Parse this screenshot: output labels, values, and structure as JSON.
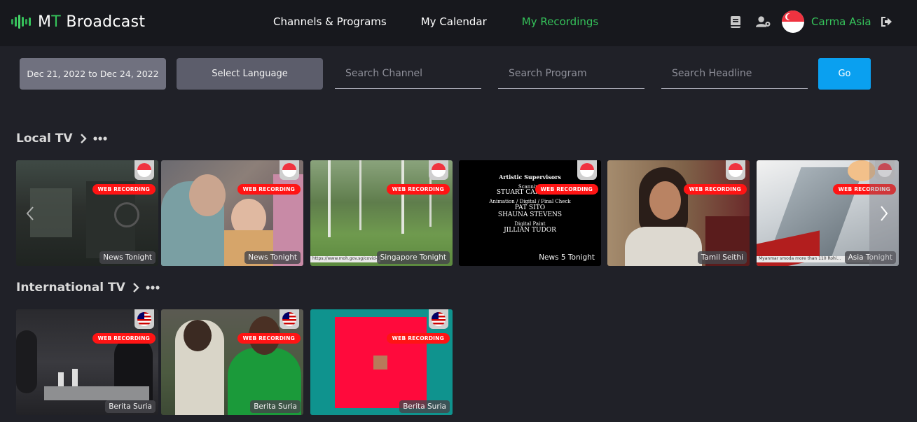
{
  "brand": {
    "name_prefix": "M",
    "name_accent": "T",
    "name_suffix": " Broadcast",
    "colors": {
      "accent": "#35c25a",
      "bars": [
        "#2fa651",
        "#35c25a",
        "#48d36a",
        "#35c25a",
        "#2fa651"
      ]
    }
  },
  "nav": {
    "items": [
      "Channels & Programs",
      "My Calendar",
      "My Recordings"
    ],
    "active": "My Recordings"
  },
  "header_icons": [
    "book-icon",
    "user-settings-icon",
    "singapore-flag-icon",
    "logout-icon"
  ],
  "user": {
    "name": "Carma Asia"
  },
  "filter": {
    "date_range": "Dec 21, 2022 to Dec 24, 2022",
    "language": "Select Language",
    "channel_placeholder": "Search Channel",
    "program_placeholder": "Search Program",
    "headline_placeholder": "Search Headline",
    "go": "Go"
  },
  "sections": {
    "local": {
      "title": "Local TV",
      "cards": [
        {
          "badge": "WEB RECORDING",
          "program": "News Tonight",
          "flag": "singapore"
        },
        {
          "badge": "WEB RECORDING",
          "program": "News Tonight",
          "flag": "singapore"
        },
        {
          "badge": "WEB RECORDING",
          "program": "Singapore Tonight",
          "flag": "singapore",
          "ticker": "https://www.moh.gov.sg/covid-19"
        },
        {
          "badge": "WEB RECORDING",
          "program": "News 5 Tonight",
          "flag": "singapore",
          "credits": [
            "Artistic Supervisors",
            "Scanning",
            "STUART CAMPBELL",
            "Animation / Digital / Final Check",
            "PAT SITO",
            "SHAUNA STEVENS",
            "Digital Paint",
            "JILLIAN TUDOR"
          ]
        },
        {
          "badge": "WEB RECORDING",
          "program": "Tamil Seithi",
          "flag": "singapore"
        },
        {
          "badge": "WEB RECORDING",
          "program": "Asia Tonight",
          "flag": "singapore",
          "ticker": "Myanmar smoda more than 110 Rohi..."
        }
      ]
    },
    "international": {
      "title": "International TV",
      "cards": [
        {
          "badge": "WEB RECORDING",
          "program": "Berita Suria",
          "flag": "malaysia"
        },
        {
          "badge": "WEB RECORDING",
          "program": "Berita Suria",
          "flag": "malaysia"
        },
        {
          "badge": "WEB RECORDING",
          "program": "Berita Suria",
          "flag": "malaysia"
        }
      ]
    }
  }
}
